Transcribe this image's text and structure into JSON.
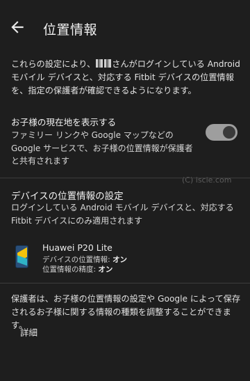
{
  "header": {
    "title": "位置情報",
    "back_icon": "arrow-back-icon"
  },
  "intro": {
    "before": "これらの設定により、",
    "after": "さんがログインしている Android モバイル デバイスと、対応する Fitbit デバイスの位置情報を、指定の保護者が確認できるようになります。"
  },
  "location_toggle": {
    "title": "お子様の現在地を表示する",
    "description": "ファミリー リンクや Google マップなどの Google サービスで、お子様の位置情報が保護者と共有されます",
    "enabled": true
  },
  "watermark": "(C) iscle.com",
  "device_section": {
    "title": "デバイスの位置情報の設定",
    "description": "ログインしている Android モバイル デバイスと、対応する Fitbit デバイスにのみ適用されます",
    "device": {
      "name": "Huawei P20 Lite",
      "location_label": "デバイスの位置情報: ",
      "location_value": "オン",
      "accuracy_label": "位置情報の精度: ",
      "accuracy_value": "オン",
      "icon": "phone-icon"
    }
  },
  "footer": {
    "text": "保護者は、お子様の位置情報の設定や Google によって保存されるお子様に関する情報の種類を調整することができます。",
    "details_label": "詳細"
  },
  "colors": {
    "background": "#1e1e1e",
    "divider": "#3c3c3c",
    "switch_track": "#9e9e9e",
    "switch_knob": "#3a3a3a"
  }
}
